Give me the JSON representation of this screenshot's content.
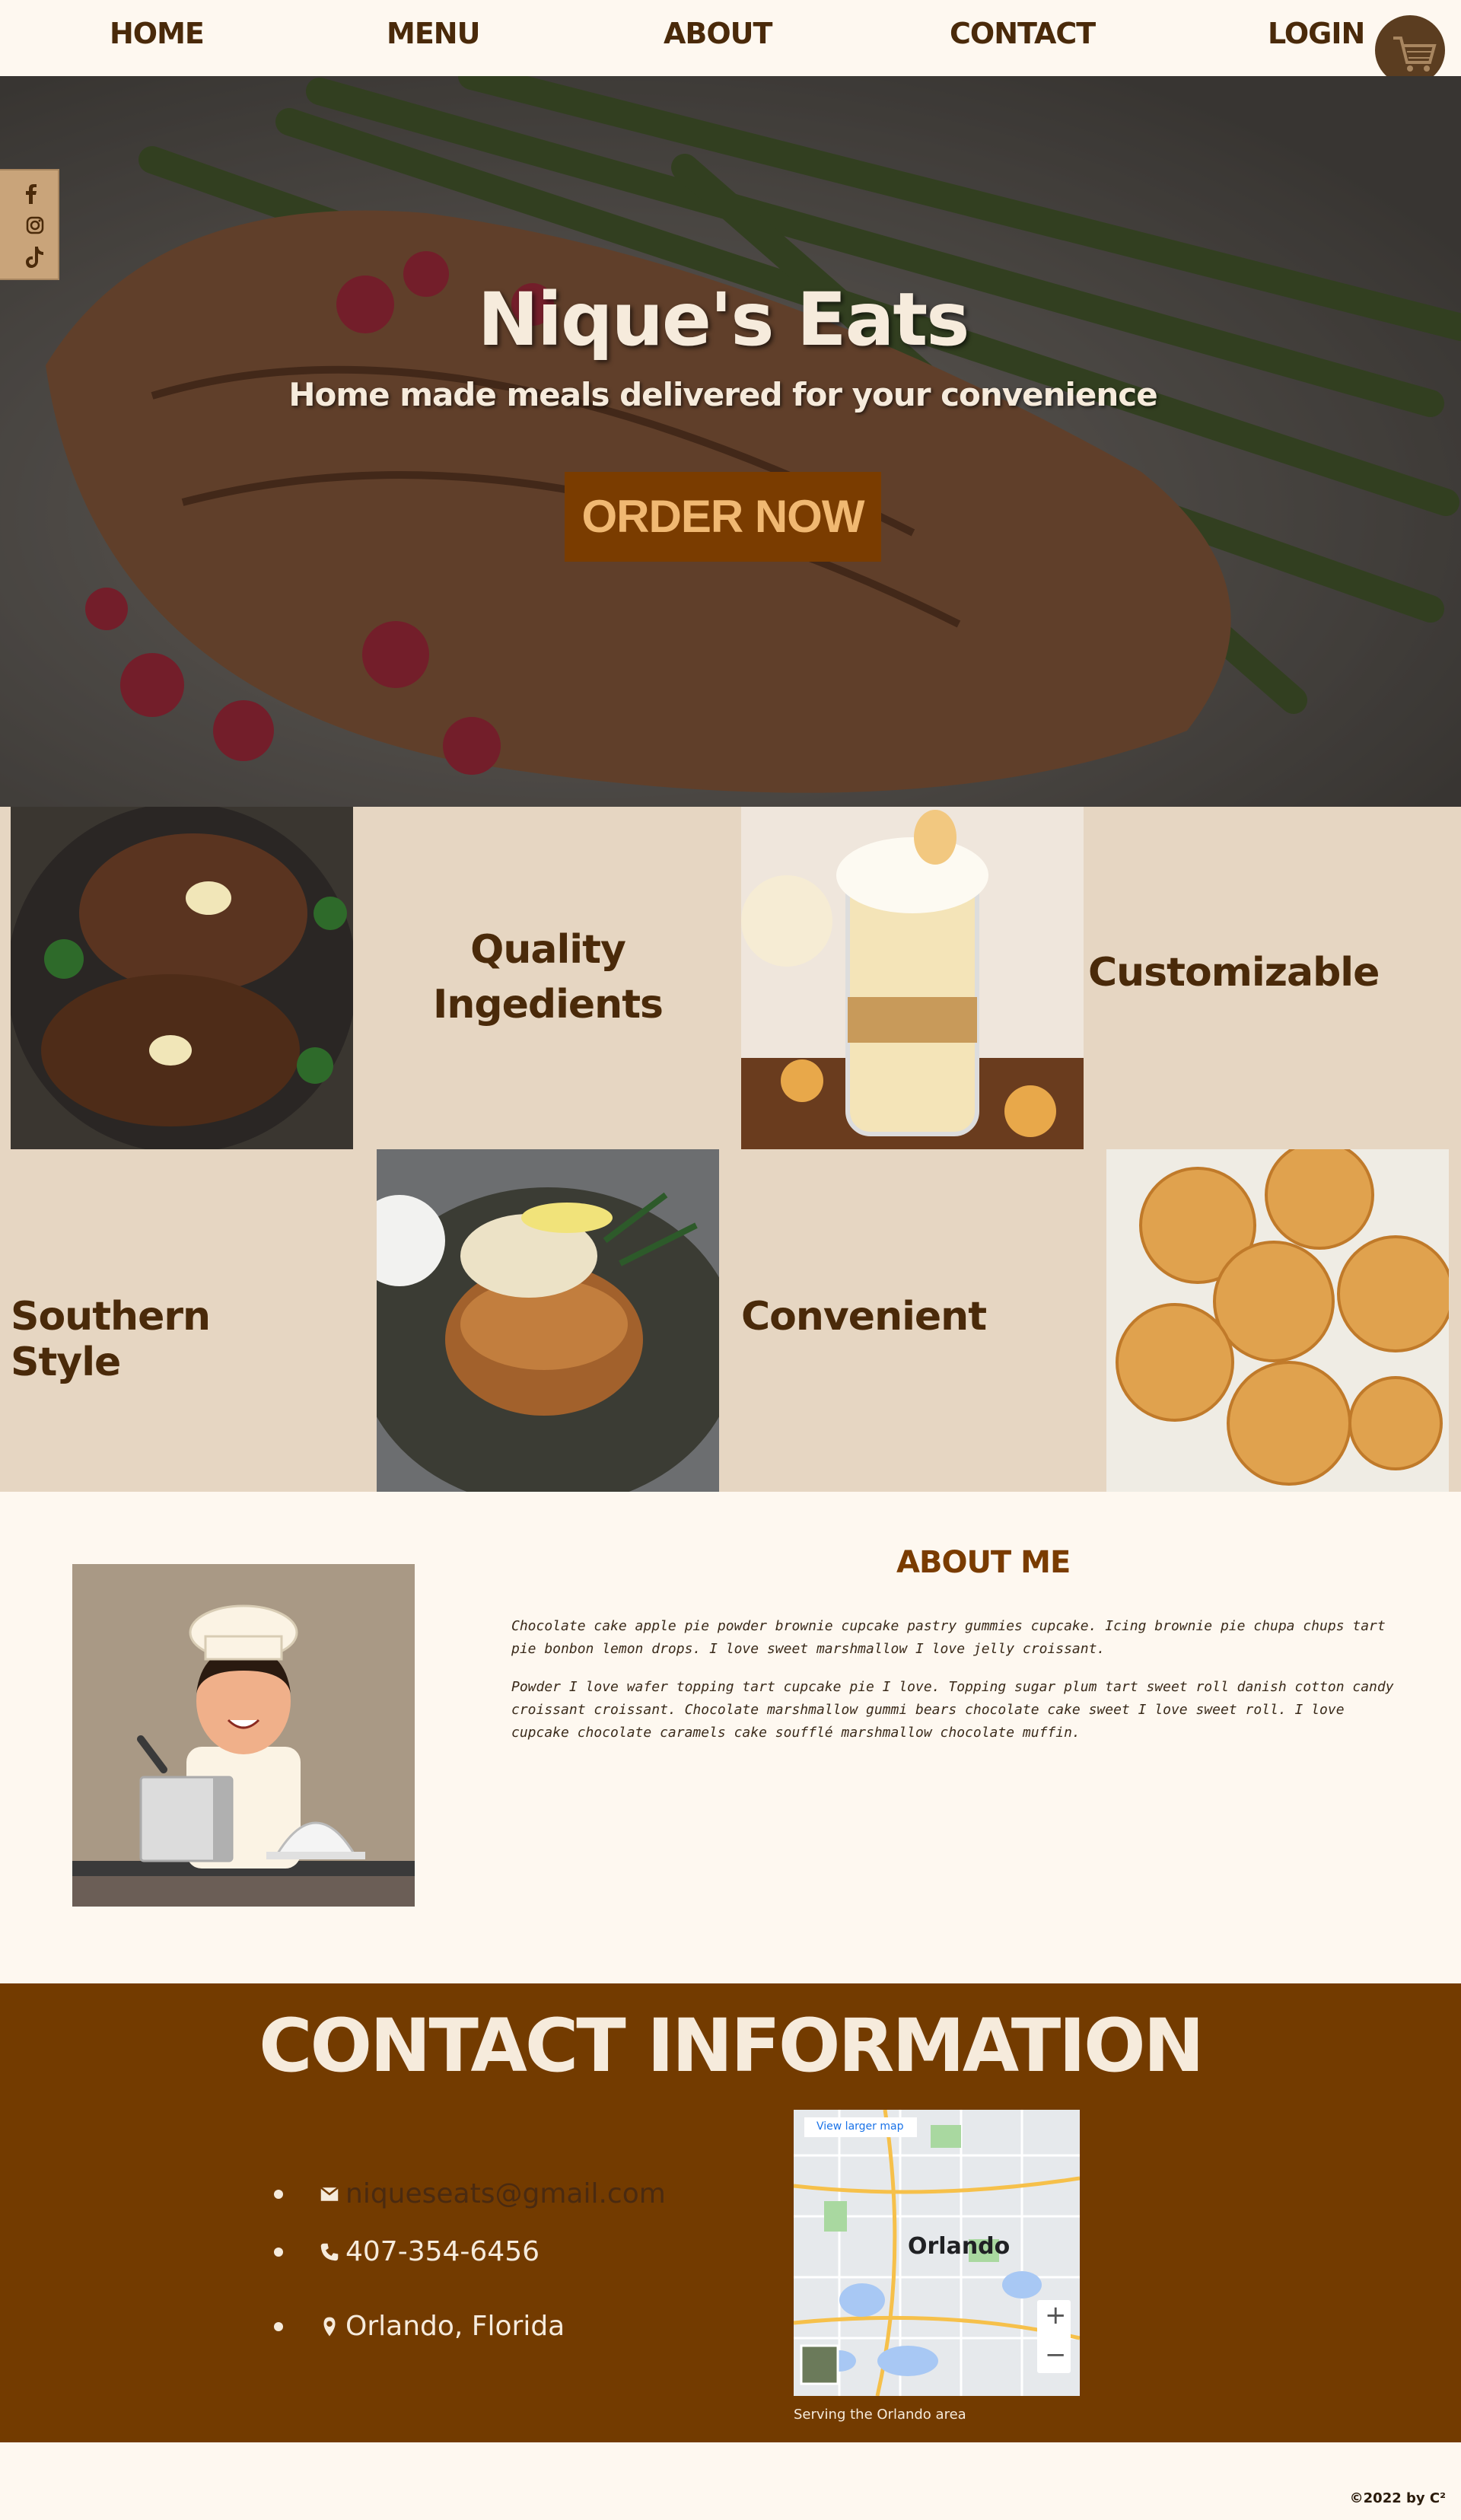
{
  "nav": {
    "home": "HOME",
    "menu": "MENU",
    "about": "ABOUT",
    "contact": "CONTACT",
    "login": "LOGIN"
  },
  "hero": {
    "title": "Nique's Eats",
    "subtitle": "Home made meals delivered for your convenience",
    "cta": "ORDER NOW"
  },
  "features": {
    "quality": "Quality Ingedients",
    "customizable": "Customizable",
    "southern": "Southern Style",
    "convenient": "Convenient"
  },
  "about": {
    "heading": "ABOUT ME",
    "p1": "Chocolate cake apple pie powder brownie cupcake pastry gummies cupcake. Icing brownie pie chupa chups tart pie bonbon lemon drops. I love sweet marshmallow I love jelly croissant.",
    "p2": "Powder I love wafer topping tart cupcake pie I love. Topping sugar plum tart sweet roll danish cotton candy croissant croissant. Chocolate marshmallow gummi bears chocolate cake sweet I love sweet roll. I love cupcake chocolate caramels cake soufflé marshmallow chocolate muffin."
  },
  "contact": {
    "heading": "CONTACT INFORMATION",
    "email": "niqueseats@gmail.com",
    "phone": "407-354-6456",
    "location": "Orlando, Florida",
    "map_caption": "Serving the Orlando area",
    "map_city": "Orlando",
    "map_link": "View larger map"
  },
  "footer": {
    "copyright": "©2022 by C²"
  }
}
